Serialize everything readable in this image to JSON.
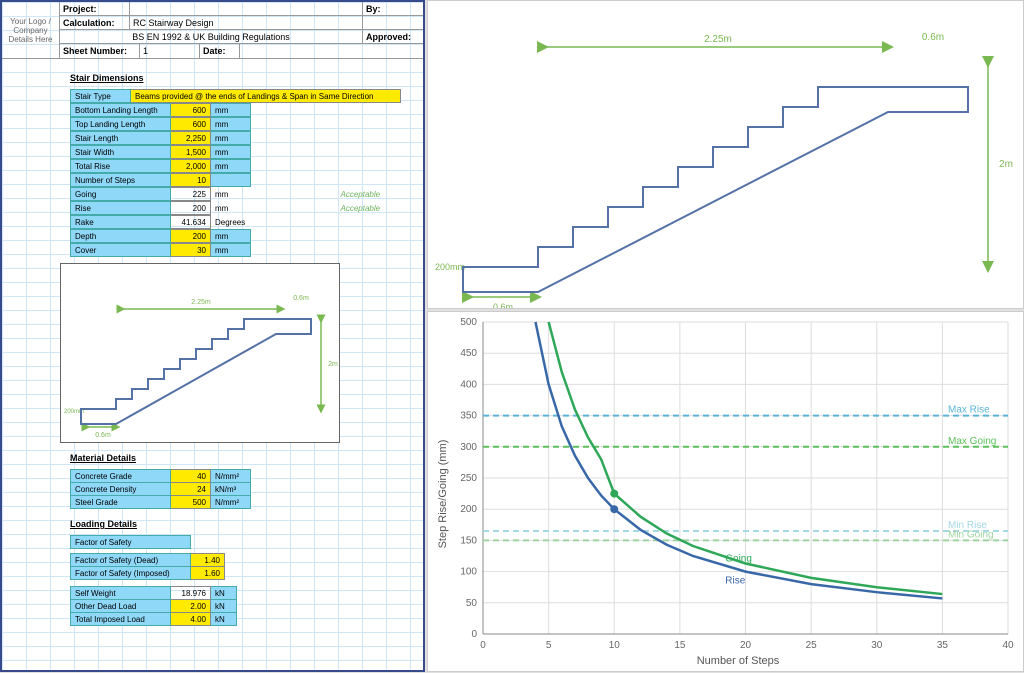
{
  "header": {
    "logo_text": "Your Logo / Company Details Here",
    "project_label": "Project:",
    "by_label": "By:",
    "calculation_label": "Calculation:",
    "calculation_value": "RC Stairway Design",
    "code_line": "BS EN 1992 & UK Building Regulations",
    "approved_label": "Approved:",
    "sheet_label": "Sheet Number:",
    "sheet_value": "1",
    "date_label": "Date:"
  },
  "sections": {
    "stair_dim": "Stair Dimensions",
    "material": "Material Details",
    "loading": "Loading Details"
  },
  "stair": {
    "type_label": "Stair Type",
    "type_value": "Beams provided @ the ends of Landings & Span in Same Direction",
    "rows": [
      {
        "label": "Bottom Landing Length",
        "val": "600",
        "unit": "mm",
        "yellow": true
      },
      {
        "label": "Top Landing Length",
        "val": "600",
        "unit": "mm",
        "yellow": true
      },
      {
        "label": "Stair Length",
        "val": "2,250",
        "unit": "mm",
        "yellow": true
      },
      {
        "label": "Stair Width",
        "val": "1,500",
        "unit": "mm",
        "yellow": true
      },
      {
        "label": "Total Rise",
        "val": "2,000",
        "unit": "mm",
        "yellow": true
      },
      {
        "label": "Number of Steps",
        "val": "10",
        "unit": "",
        "yellow": true
      },
      {
        "label": "Going",
        "val": "225",
        "unit": "mm",
        "yellow": false,
        "status": "Acceptable"
      },
      {
        "label": "Rise",
        "val": "200",
        "unit": "mm",
        "yellow": false,
        "status": "Acceptable"
      },
      {
        "label": "Rake",
        "val": "41.634",
        "unit": "Degrees",
        "yellow": false
      },
      {
        "label": "Depth",
        "val": "200",
        "unit": "mm",
        "yellow": true
      },
      {
        "label": "Cover",
        "val": "30",
        "unit": "mm",
        "yellow": true
      }
    ]
  },
  "material": [
    {
      "label": "Concrete Grade",
      "val": "40",
      "unit": "N/mm²"
    },
    {
      "label": "Concrete Density",
      "val": "24",
      "unit": "kN/m³"
    },
    {
      "label": "Steel Grade",
      "val": "500",
      "unit": "N/mm²"
    }
  ],
  "loading": {
    "fos_label": "Factor of Safety",
    "fos": [
      {
        "label": "Factor of Safety (Dead)",
        "val": "1.40"
      },
      {
        "label": "Factor of Safety (Imposed)",
        "val": "1.60"
      }
    ],
    "loads": [
      {
        "label": "Self Weight",
        "val": "18.976",
        "unit": "kN",
        "yellow": false
      },
      {
        "label": "Other Dead Load",
        "val": "2.00",
        "unit": "kN",
        "yellow": true
      },
      {
        "label": "Total Imposed Load",
        "val": "4.00",
        "unit": "kN",
        "yellow": true
      }
    ]
  },
  "stair_diagram": {
    "bottom_landing": "0.6m",
    "top_landing": "0.6m",
    "span": "2.25m",
    "rise": "2m",
    "h200": "200mm"
  },
  "chart_data": {
    "type": "line",
    "title": "",
    "xlabel": "Number of Steps",
    "ylabel": "Step Rise/Going  (mm)",
    "xlim": [
      0,
      40
    ],
    "ylim": [
      0,
      500
    ],
    "xticks": [
      0,
      5,
      10,
      15,
      20,
      25,
      30,
      35,
      40
    ],
    "yticks": [
      0,
      50,
      100,
      150,
      200,
      250,
      300,
      350,
      400,
      450,
      500
    ],
    "ref_lines": [
      {
        "name": "Max Rise",
        "y": 350,
        "color": "#5ab4d8"
      },
      {
        "name": "Max Going",
        "y": 300,
        "color": "#5cbf5c"
      },
      {
        "name": "Min Rise",
        "y": 165,
        "color": "#a4d8e4"
      },
      {
        "name": "Min Going",
        "y": 150,
        "color": "#9fd4a0"
      }
    ],
    "series": [
      {
        "name": "Rise",
        "color": "#3968a8",
        "x": [
          4,
          5,
          6,
          7,
          8,
          9,
          10,
          12,
          14,
          16,
          20,
          25,
          30,
          35
        ],
        "y": [
          500,
          400,
          333,
          286,
          250,
          222,
          200,
          167,
          143,
          125,
          100,
          80,
          67,
          57
        ],
        "marker_at": {
          "x": 10,
          "y": 200
        }
      },
      {
        "name": "Going",
        "color": "#2ea858",
        "x": [
          5,
          6,
          7,
          8,
          9,
          10,
          12,
          14,
          16,
          20,
          25,
          30,
          35
        ],
        "y": [
          500,
          420,
          360,
          315,
          280,
          225,
          188,
          161,
          141,
          113,
          90,
          75,
          64
        ],
        "marker_at": {
          "x": 10,
          "y": 225
        }
      }
    ]
  }
}
